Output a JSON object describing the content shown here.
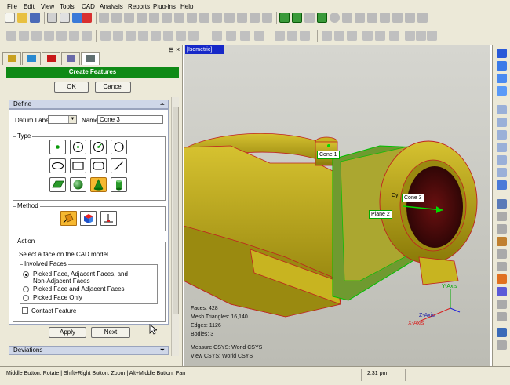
{
  "menu": [
    "File",
    "Edit",
    "View",
    "Tools",
    "CAD",
    "Analysis",
    "Reports",
    "Plug-ins",
    "Help"
  ],
  "panel": {
    "title": "Create Features",
    "ok": "OK",
    "cancel": "Cancel",
    "define": {
      "header": "Define",
      "datum_label": "Datum Label",
      "datum_value": "",
      "name_label": "Name",
      "name_value": "Cone 3"
    },
    "type": {
      "label": "Type",
      "buttons": [
        "point-icon",
        "circle-target-icon",
        "gauge-icon",
        "circle-icon",
        "slot-icon",
        "rectangle-icon",
        "rounded-slot-icon",
        "line-icon",
        "plane-icon",
        "sphere-icon",
        "cone-icon",
        "cylinder-icon"
      ],
      "selected": "cone-icon"
    },
    "method": {
      "label": "Method",
      "buttons": [
        "pick-face-icon",
        "pick-solid-icon",
        "pick-axis-icon"
      ],
      "selected": "pick-face-icon"
    },
    "action": {
      "label": "Action",
      "instruction": "Select a face on the CAD model",
      "involved_faces": "Involved Faces",
      "options": [
        "Picked Face, Adjacent Faces, and",
        "Non-Adjacent Faces",
        "Picked Face and Adjacent Faces",
        "Picked Face Only"
      ],
      "selected_option": 0,
      "contact_feature": "Contact Feature"
    },
    "apply": "Apply",
    "next": "Next",
    "deviations": "Deviations"
  },
  "viewport": {
    "view_name": "[Isometric]",
    "labels": {
      "cone1": "Cone 1",
      "plane2": "Plane 2",
      "cone3": "Cone 3",
      "cyl": "Cyl"
    },
    "stats": {
      "faces": "Faces: 428",
      "mesh": "Mesh Triangles: 16,140",
      "edges": "Edges: 1126",
      "bodies": "Bodies: 3"
    },
    "measure_csys": "Measure CSYS: World CSYS",
    "view_csys": "View CSYS: World CSYS",
    "axes": {
      "y": "Y-Axis",
      "z": "Z-Axis",
      "x": "X-Axis"
    }
  },
  "status": {
    "hint": "Middle Button: Rotate | Shift+Right Button: Zoom | Alt+Middle Button: Pan",
    "time": "2:31 pm"
  },
  "colors": {
    "accent_green": "#0f8a16",
    "model_yellow": "#b5a314",
    "selection_blue": "#1628c8"
  }
}
